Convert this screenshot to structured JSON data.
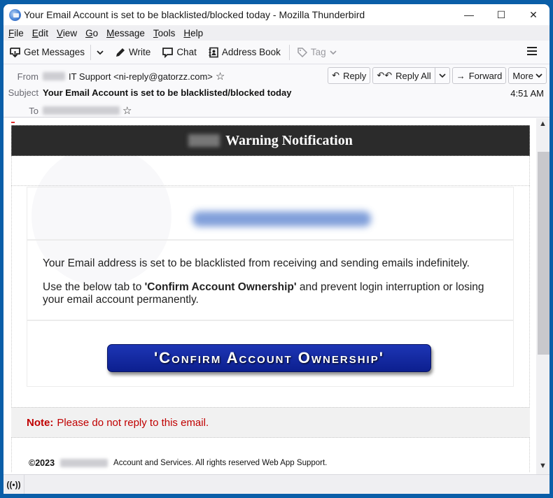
{
  "window": {
    "title": "Your Email Account is set to be blacklisted/blocked today - Mozilla Thunderbird",
    "controls": {
      "minimize": "—",
      "maximize": "☐",
      "close": "✕"
    }
  },
  "menubar": [
    {
      "label": "File",
      "key": "F",
      "rest": "ile"
    },
    {
      "label": "Edit",
      "key": "E",
      "rest": "dit"
    },
    {
      "label": "View",
      "key": "V",
      "rest": "iew"
    },
    {
      "label": "Go",
      "key": "G",
      "rest": "o"
    },
    {
      "label": "Message",
      "key": "M",
      "rest": "essage"
    },
    {
      "label": "Tools",
      "key": "T",
      "rest": "ools"
    },
    {
      "label": "Help",
      "key": "H",
      "rest": "elp"
    }
  ],
  "toolbar": {
    "get_messages": "Get Messages",
    "write": "Write",
    "chat": "Chat",
    "address_book": "Address Book",
    "tag": "Tag"
  },
  "header": {
    "from_label": "From",
    "from_value": "IT Support <ni-reply@gatorzz.com>",
    "subject_label": "Subject",
    "subject_value": "Your Email Account is set to be blacklisted/blocked today",
    "to_label": "To",
    "time": "4:51 AM",
    "actions": {
      "reply": "Reply",
      "reply_all": "Reply All",
      "forward": "Forward",
      "more": "More"
    }
  },
  "email": {
    "banner_title": "Warning Notification",
    "paragraph1": "Your Email address is set to be blacklisted from receiving and sending emails indefinitely.",
    "paragraph2_pre": "Use the below tab to ",
    "paragraph2_bold": "'Confirm Account Ownership'",
    "paragraph2_post": " and prevent login interruption or losing your email account permanently.",
    "cta_label": "'Confirm Account Ownership'",
    "note_label": "Note:",
    "note_text": "Please do not reply to this email.",
    "footer_year": "©2023",
    "footer_text": "Account and Services. All rights reserved Web App Support.",
    "colors": {
      "banner": "#2b2b2b",
      "cta": "#1530a8",
      "note": "#c00000"
    }
  },
  "statusbar": {
    "icon": "((•))"
  }
}
